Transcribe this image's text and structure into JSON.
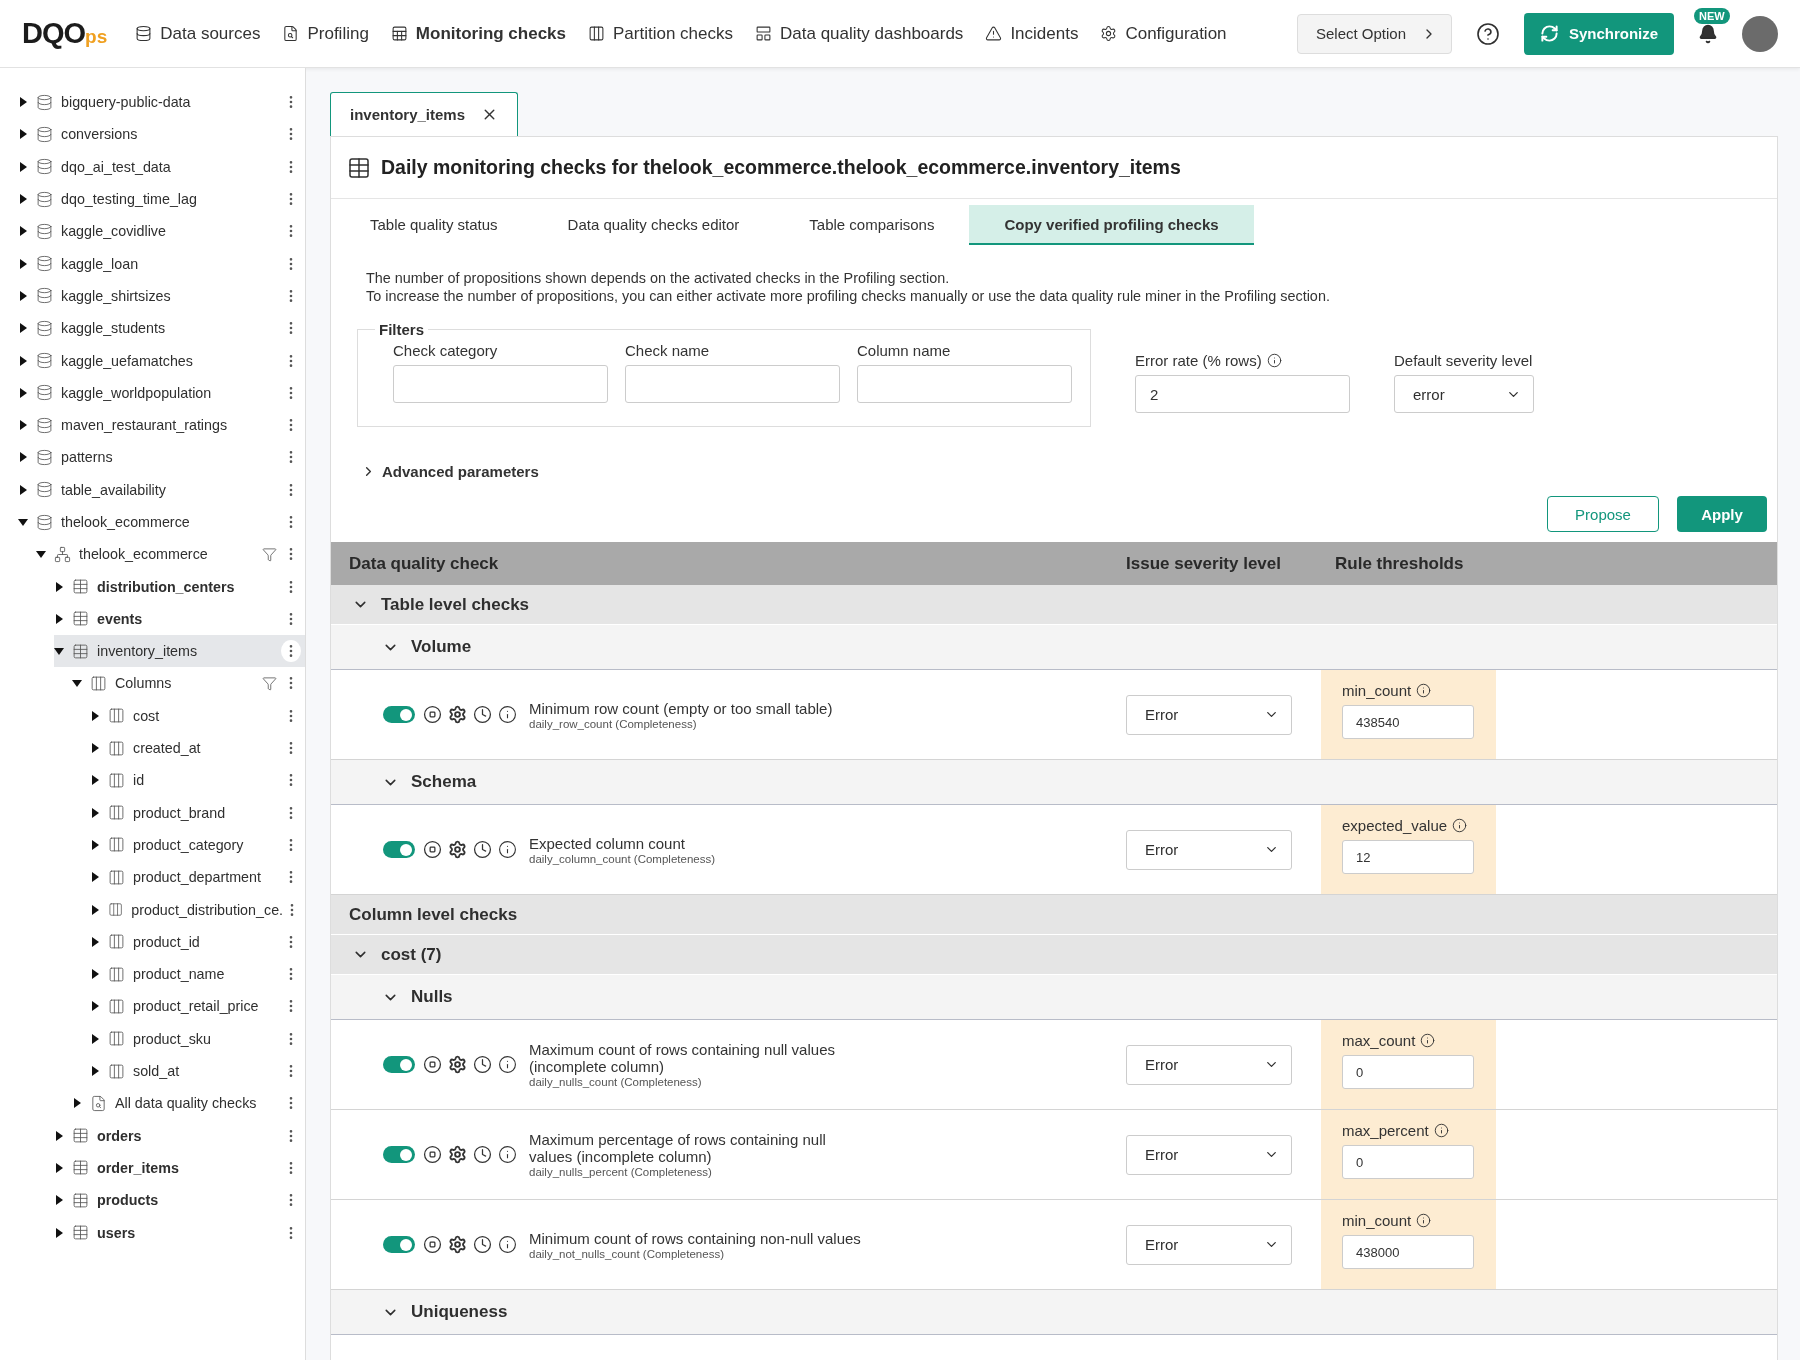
{
  "header": {
    "logo_main": "DQO",
    "logo_suffix": "ps",
    "nav": [
      {
        "label": "Data sources",
        "kind": "sources",
        "selected": false
      },
      {
        "label": "Profiling",
        "kind": "profiling",
        "selected": false
      },
      {
        "label": "Monitoring checks",
        "kind": "monitoring",
        "selected": true
      },
      {
        "label": "Partition checks",
        "kind": "partition",
        "selected": false
      },
      {
        "label": "Data quality dashboards",
        "kind": "dashboards",
        "selected": false
      },
      {
        "label": "Incidents",
        "kind": "incidents",
        "selected": false
      },
      {
        "label": "Configuration",
        "kind": "configuration",
        "selected": false
      }
    ],
    "select_option": "Select Option",
    "synchronize": "Synchronize",
    "new_badge": "NEW"
  },
  "sidebar": {
    "tree": [
      {
        "label": "bigquery-public-data",
        "kind": "database",
        "expanded": false
      },
      {
        "label": "conversions",
        "kind": "database",
        "expanded": false
      },
      {
        "label": "dqo_ai_test_data",
        "kind": "database",
        "expanded": false
      },
      {
        "label": "dqo_testing_time_lag",
        "kind": "database",
        "expanded": false
      },
      {
        "label": "kaggle_covidlive",
        "kind": "database",
        "expanded": false
      },
      {
        "label": "kaggle_loan",
        "kind": "database",
        "expanded": false
      },
      {
        "label": "kaggle_shirtsizes",
        "kind": "database",
        "expanded": false
      },
      {
        "label": "kaggle_students",
        "kind": "database",
        "expanded": false
      },
      {
        "label": "kaggle_uefamatches",
        "kind": "database",
        "expanded": false
      },
      {
        "label": "kaggle_worldpopulation",
        "kind": "database",
        "expanded": false
      },
      {
        "label": "maven_restaurant_ratings",
        "kind": "database",
        "expanded": false
      },
      {
        "label": "patterns",
        "kind": "database",
        "expanded": false
      },
      {
        "label": "table_availability",
        "kind": "database",
        "expanded": false
      },
      {
        "label": "thelook_ecommerce",
        "kind": "database",
        "expanded": true,
        "children": [
          {
            "label": "thelook_ecommerce",
            "kind": "schema",
            "expanded": true,
            "children": [
              {
                "label": "distribution_centers",
                "kind": "table",
                "expanded": false,
                "emphasized": true,
                "selected": false
              },
              {
                "label": "events",
                "kind": "table",
                "expanded": false,
                "emphasized": true,
                "selected": false
              },
              {
                "label": "inventory_items",
                "kind": "table",
                "expanded": true,
                "emphasized": false,
                "selected": true,
                "children": [
                  {
                    "label": "Columns",
                    "kind": "columns",
                    "expanded": true,
                    "children": [
                      {
                        "label": "cost",
                        "kind": "column",
                        "expanded": false
                      },
                      {
                        "label": "created_at",
                        "kind": "column",
                        "expanded": false
                      },
                      {
                        "label": "id",
                        "kind": "column",
                        "expanded": false
                      },
                      {
                        "label": "product_brand",
                        "kind": "column",
                        "expanded": false
                      },
                      {
                        "label": "product_category",
                        "kind": "column",
                        "expanded": false
                      },
                      {
                        "label": "product_department",
                        "kind": "column",
                        "expanded": false
                      },
                      {
                        "label": "product_distribution_ce.",
                        "kind": "column",
                        "expanded": false
                      },
                      {
                        "label": "product_id",
                        "kind": "column",
                        "expanded": false
                      },
                      {
                        "label": "product_name",
                        "kind": "column",
                        "expanded": false
                      },
                      {
                        "label": "product_retail_price",
                        "kind": "column",
                        "expanded": false
                      },
                      {
                        "label": "product_sku",
                        "kind": "column",
                        "expanded": false
                      },
                      {
                        "label": "sold_at",
                        "kind": "column",
                        "expanded": false
                      }
                    ]
                  },
                  {
                    "label": "All data quality checks",
                    "kind": "checks",
                    "expanded": false
                  }
                ]
              },
              {
                "label": "orders",
                "kind": "table",
                "expanded": false,
                "emphasized": true,
                "selected": false
              },
              {
                "label": "order_items",
                "kind": "table",
                "expanded": false,
                "emphasized": true,
                "selected": false
              },
              {
                "label": "products",
                "kind": "table",
                "expanded": false,
                "emphasized": true,
                "selected": false
              },
              {
                "label": "users",
                "kind": "table",
                "expanded": false,
                "emphasized": true,
                "selected": false
              }
            ]
          }
        ]
      }
    ]
  },
  "open_tab": {
    "label": "inventory_items"
  },
  "title": "Daily monitoring checks for thelook_ecommerce.thelook_ecommerce.inventory_items",
  "tabs": [
    {
      "label": "Table quality status",
      "selected": false
    },
    {
      "label": "Data quality checks editor",
      "selected": false
    },
    {
      "label": "Table comparisons",
      "selected": false
    },
    {
      "label": "Copy verified profiling checks",
      "selected": true
    }
  ],
  "notes": [
    "The number of propositions shown depends on the activated checks in the Profiling section.",
    "To increase the number of propositions, you can either activate more profiling checks manually or use the data quality rule miner in the Profiling section."
  ],
  "filters": {
    "legend": "Filters",
    "fields": [
      {
        "label": "Check category"
      },
      {
        "label": "Check name"
      },
      {
        "label": "Column name"
      }
    ]
  },
  "error_rate": {
    "label": "Error rate (% rows)",
    "value": "2"
  },
  "default_severity": {
    "label": "Default severity level",
    "value": "error"
  },
  "advanced": {
    "label": "Advanced parameters",
    "expanded": false
  },
  "buttons": {
    "propose": "Propose",
    "apply": "Apply"
  },
  "checks_table": {
    "columns": [
      "Data quality check",
      "Issue severity level",
      "Rule thresholds"
    ],
    "rows": [
      {
        "kind": "group",
        "title": "Table level checks",
        "expanded": true,
        "children": [
          {
            "kind": "category",
            "title": "Volume",
            "expanded": true,
            "children": [
              {
                "kind": "check",
                "enabled": true,
                "name": "Minimum row count (empty or too small table)",
                "subtitle": "daily_row_count (Completeness)",
                "severity": "Error",
                "threshold_label": "min_count",
                "threshold_value": "438540"
              }
            ]
          },
          {
            "kind": "category",
            "title": "Schema",
            "expanded": true,
            "children": [
              {
                "kind": "check",
                "enabled": true,
                "name": "Expected column count",
                "subtitle": "daily_column_count (Completeness)",
                "severity": "Error",
                "threshold_label": "expected_value",
                "threshold_value": "12"
              }
            ]
          }
        ]
      },
      {
        "kind": "section",
        "title": "Column level checks",
        "children": [
          {
            "kind": "group",
            "title": "cost (7)",
            "expanded": true,
            "children": [
              {
                "kind": "category",
                "title": "Nulls",
                "expanded": true,
                "children": [
                  {
                    "kind": "check",
                    "enabled": true,
                    "name": "Maximum count of rows containing null values (incomplete column)",
                    "subtitle": "daily_nulls_count (Completeness)",
                    "severity": "Error",
                    "threshold_label": "max_count",
                    "threshold_value": "0"
                  },
                  {
                    "kind": "check",
                    "enabled": true,
                    "name": "Maximum percentage of rows containing null values (incomplete column)",
                    "subtitle": "daily_nulls_percent (Completeness)",
                    "severity": "Error",
                    "threshold_label": "max_percent",
                    "threshold_value": "0"
                  },
                  {
                    "kind": "check",
                    "enabled": true,
                    "name": "Minimum count of rows containing non-null values",
                    "subtitle": "daily_not_nulls_count (Completeness)",
                    "severity": "Error",
                    "threshold_label": "min_count",
                    "threshold_value": "438000"
                  }
                ]
              },
              {
                "kind": "category",
                "title": "Uniqueness",
                "expanded": true
              }
            ]
          }
        ]
      }
    ]
  }
}
